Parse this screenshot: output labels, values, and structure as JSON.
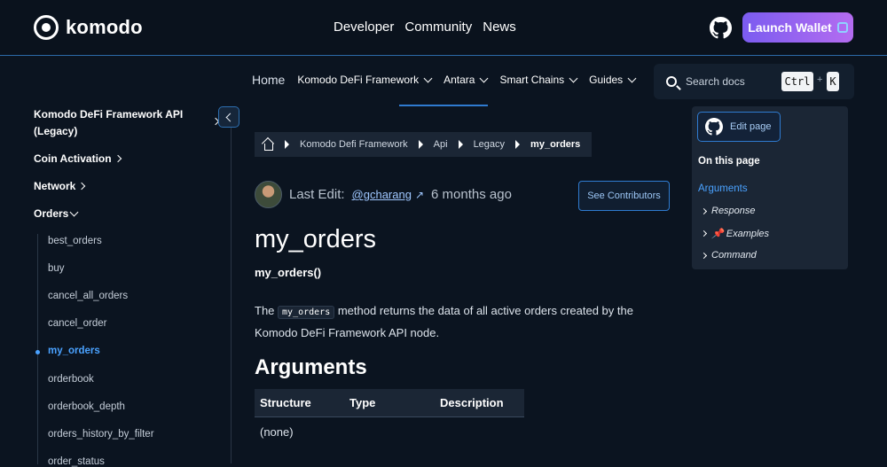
{
  "header": {
    "brand": "komodo",
    "nav": [
      "Developer",
      "Community",
      "News"
    ],
    "launch_label": "Launch Wallet"
  },
  "subnav": {
    "home": "Home",
    "items": [
      "Komodo DeFi Framework",
      "Antara",
      "Smart Chains",
      "Guides"
    ],
    "search_placeholder": "Search docs",
    "kbd_ctrl": "Ctrl",
    "kbd_plus": "+",
    "kbd_k": "K"
  },
  "sidebar": {
    "top": "Komodo DeFi Framework API (Legacy)",
    "categories": [
      "Coin Activation",
      "Network",
      "Orders"
    ],
    "orders_items": [
      "best_orders",
      "buy",
      "cancel_all_orders",
      "cancel_order",
      "my_orders",
      "orderbook",
      "orderbook_depth",
      "orders_history_by_filter",
      "order_status"
    ],
    "active_item": "my_orders"
  },
  "breadcrumb": [
    "Komodo Defi Framework",
    "Api",
    "Legacy",
    "my_orders"
  ],
  "meta": {
    "last_edit_label": "Last Edit:",
    "editor": "@gcharang",
    "arrow": "↗",
    "time_ago": "6 months ago",
    "contributors_label": "See Contributors"
  },
  "content": {
    "title": "my_orders",
    "signature": "my_orders()",
    "desc_pre": "The",
    "desc_code": "my_orders",
    "desc_post": "method returns the data of all active orders created by the Komodo DeFi Framework API node.",
    "arguments_heading": "Arguments",
    "table": {
      "headers": [
        "Structure",
        "Type",
        "Description"
      ],
      "rows": [
        [
          "(none)",
          "",
          ""
        ]
      ]
    }
  },
  "toc": {
    "edit_label": "Edit page",
    "title": "On this page",
    "items": [
      "Arguments",
      "Response",
      "📌 Examples",
      "Command"
    ]
  },
  "colors": {
    "background": "#0b1420",
    "accent": "#4aa2ff",
    "launch_gradient": [
      "#7b5cf0",
      "#b46cf0"
    ]
  }
}
